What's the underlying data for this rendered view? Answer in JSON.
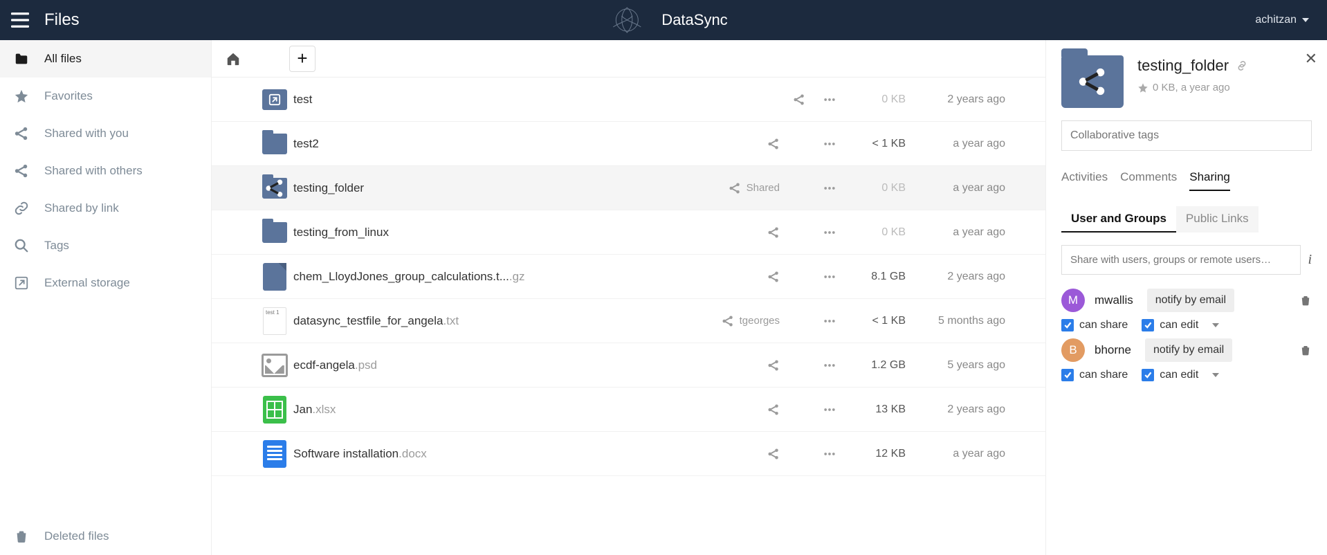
{
  "header": {
    "app_label": "Files",
    "brand": "DataSync",
    "username": "achitzan"
  },
  "sidebar": {
    "items": [
      {
        "label": "All files",
        "active": true,
        "icon": "folder"
      },
      {
        "label": "Favorites",
        "active": false,
        "icon": "star"
      },
      {
        "label": "Shared with you",
        "active": false,
        "icon": "share"
      },
      {
        "label": "Shared with others",
        "active": false,
        "icon": "share"
      },
      {
        "label": "Shared by link",
        "active": false,
        "icon": "link"
      },
      {
        "label": "Tags",
        "active": false,
        "icon": "search"
      },
      {
        "label": "External storage",
        "active": false,
        "icon": "external"
      }
    ],
    "deleted_label": "Deleted files"
  },
  "files": [
    {
      "name": "test",
      "ext": "",
      "icon": "external-share",
      "share_text": "",
      "show_share_icon": false,
      "size": "0 KB",
      "size_light": true,
      "date": "2 years ago",
      "selected": false
    },
    {
      "name": "test2",
      "ext": "",
      "icon": "folder",
      "share_text": "",
      "show_share_icon": true,
      "size": "< 1 KB",
      "size_light": false,
      "date": "a year ago",
      "selected": false
    },
    {
      "name": "testing_folder",
      "ext": "",
      "icon": "folder-shared",
      "share_text": "Shared",
      "show_share_icon": true,
      "size": "0 KB",
      "size_light": true,
      "date": "a year ago",
      "selected": true
    },
    {
      "name": "testing_from_linux",
      "ext": "",
      "icon": "folder",
      "share_text": "",
      "show_share_icon": true,
      "size": "0 KB",
      "size_light": true,
      "date": "a year ago",
      "selected": false
    },
    {
      "name": "chem_LloydJones_group_calculations.t...",
      "ext": ".gz",
      "icon": "generic",
      "share_text": "",
      "show_share_icon": true,
      "size": "8.1 GB",
      "size_light": false,
      "date": "2 years ago",
      "selected": false
    },
    {
      "name": "datasync_testfile_for_angela",
      "ext": ".txt",
      "icon": "txt",
      "icon_text": "test 1",
      "share_text": "tgeorges",
      "show_share_icon": true,
      "size": "< 1 KB",
      "size_light": false,
      "date": "5 months ago",
      "selected": false
    },
    {
      "name": "ecdf-angela",
      "ext": ".psd",
      "icon": "image",
      "share_text": "",
      "show_share_icon": true,
      "size": "1.2 GB",
      "size_light": false,
      "date": "5 years ago",
      "selected": false
    },
    {
      "name": "Jan",
      "ext": ".xlsx",
      "icon": "xls",
      "share_text": "",
      "show_share_icon": true,
      "size": "13 KB",
      "size_light": false,
      "date": "2 years ago",
      "selected": false
    },
    {
      "name": "Software installation",
      "ext": ".docx",
      "icon": "doc",
      "share_text": "",
      "show_share_icon": true,
      "size": "12 KB",
      "size_light": false,
      "date": "a year ago",
      "selected": false
    }
  ],
  "details": {
    "title": "testing_folder",
    "meta": "0 KB, a year ago",
    "tags_placeholder": "Collaborative tags",
    "tabs": [
      {
        "label": "Activities",
        "active": false
      },
      {
        "label": "Comments",
        "active": false
      },
      {
        "label": "Sharing",
        "active": true
      }
    ],
    "subtabs": [
      {
        "label": "User and Groups",
        "active": true
      },
      {
        "label": "Public Links",
        "active": false
      }
    ],
    "share_placeholder": "Share with users, groups or remote users…",
    "notify_label": "notify by email",
    "can_share_label": "can share",
    "can_edit_label": "can edit",
    "collaborators": [
      {
        "name": "mwallis",
        "initial": "M",
        "color": "#9b59d8",
        "can_share": true,
        "can_edit": true
      },
      {
        "name": "bhorne",
        "initial": "B",
        "color": "#e29b62",
        "can_share": true,
        "can_edit": true
      }
    ]
  }
}
